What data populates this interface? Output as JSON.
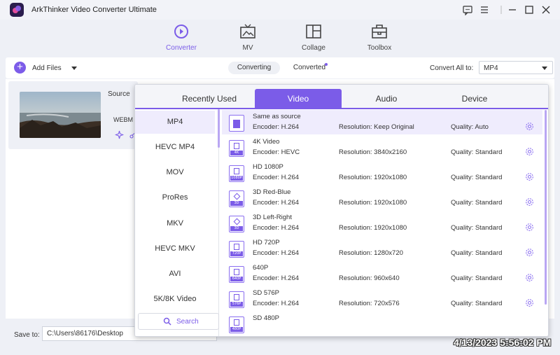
{
  "app": {
    "title": "ArkThinker Video Converter Ultimate"
  },
  "nav": [
    {
      "label": "Converter",
      "icon": "converter-icon",
      "active": true
    },
    {
      "label": "MV",
      "icon": "mv-icon",
      "active": false
    },
    {
      "label": "Collage",
      "icon": "collage-icon",
      "active": false
    },
    {
      "label": "Toolbox",
      "icon": "toolbox-icon",
      "active": false
    }
  ],
  "toolbar": {
    "add_files": "Add Files",
    "tab_converting": "Converting",
    "tab_converted": "Converted",
    "convert_all_label": "Convert All to:",
    "convert_all_value": "MP4"
  },
  "file": {
    "source_label": "Source",
    "format": "WEBM"
  },
  "bottom": {
    "save_to_label": "Save to:",
    "save_path": "C:\\Users\\86176\\Desktop"
  },
  "timestamp": "4/13/2023 5:56:02 PM",
  "popup": {
    "tabs": [
      "Recently Used",
      "Video",
      "Audio",
      "Device"
    ],
    "active_tab": "Video",
    "formats": [
      "MP4",
      "HEVC MP4",
      "MOV",
      "ProRes",
      "MKV",
      "HEVC MKV",
      "AVI",
      "5K/8K Video"
    ],
    "active_format": "MP4",
    "search_label": "Search",
    "presets": [
      {
        "name": "Same as source",
        "badge": "",
        "encoder": "Encoder: H.264",
        "resolution": "Resolution: Keep Original",
        "quality": "Quality: Auto"
      },
      {
        "name": "4K Video",
        "badge": "4K",
        "encoder": "Encoder: HEVC",
        "resolution": "Resolution: 3840x2160",
        "quality": "Quality: Standard"
      },
      {
        "name": "HD 1080P",
        "badge": "1080P",
        "encoder": "Encoder: H.264",
        "resolution": "Resolution: 1920x1080",
        "quality": "Quality: Standard"
      },
      {
        "name": "3D Red-Blue",
        "badge": "3D",
        "encoder": "Encoder: H.264",
        "resolution": "Resolution: 1920x1080",
        "quality": "Quality: Standard"
      },
      {
        "name": "3D Left-Right",
        "badge": "3D",
        "encoder": "Encoder: H.264",
        "resolution": "Resolution: 1920x1080",
        "quality": "Quality: Standard"
      },
      {
        "name": "HD 720P",
        "badge": "720P",
        "encoder": "Encoder: H.264",
        "resolution": "Resolution: 1280x720",
        "quality": "Quality: Standard"
      },
      {
        "name": "640P",
        "badge": "640P",
        "encoder": "Encoder: H.264",
        "resolution": "Resolution: 960x640",
        "quality": "Quality: Standard"
      },
      {
        "name": "SD 576P",
        "badge": "576P",
        "encoder": "Encoder: H.264",
        "resolution": "Resolution: 720x576",
        "quality": "Quality: Standard"
      },
      {
        "name": "SD 480P",
        "badge": "480P",
        "encoder": "",
        "resolution": "",
        "quality": ""
      }
    ]
  },
  "colors": {
    "accent": "#7b5ce8",
    "accent_light": "#efecfd"
  }
}
